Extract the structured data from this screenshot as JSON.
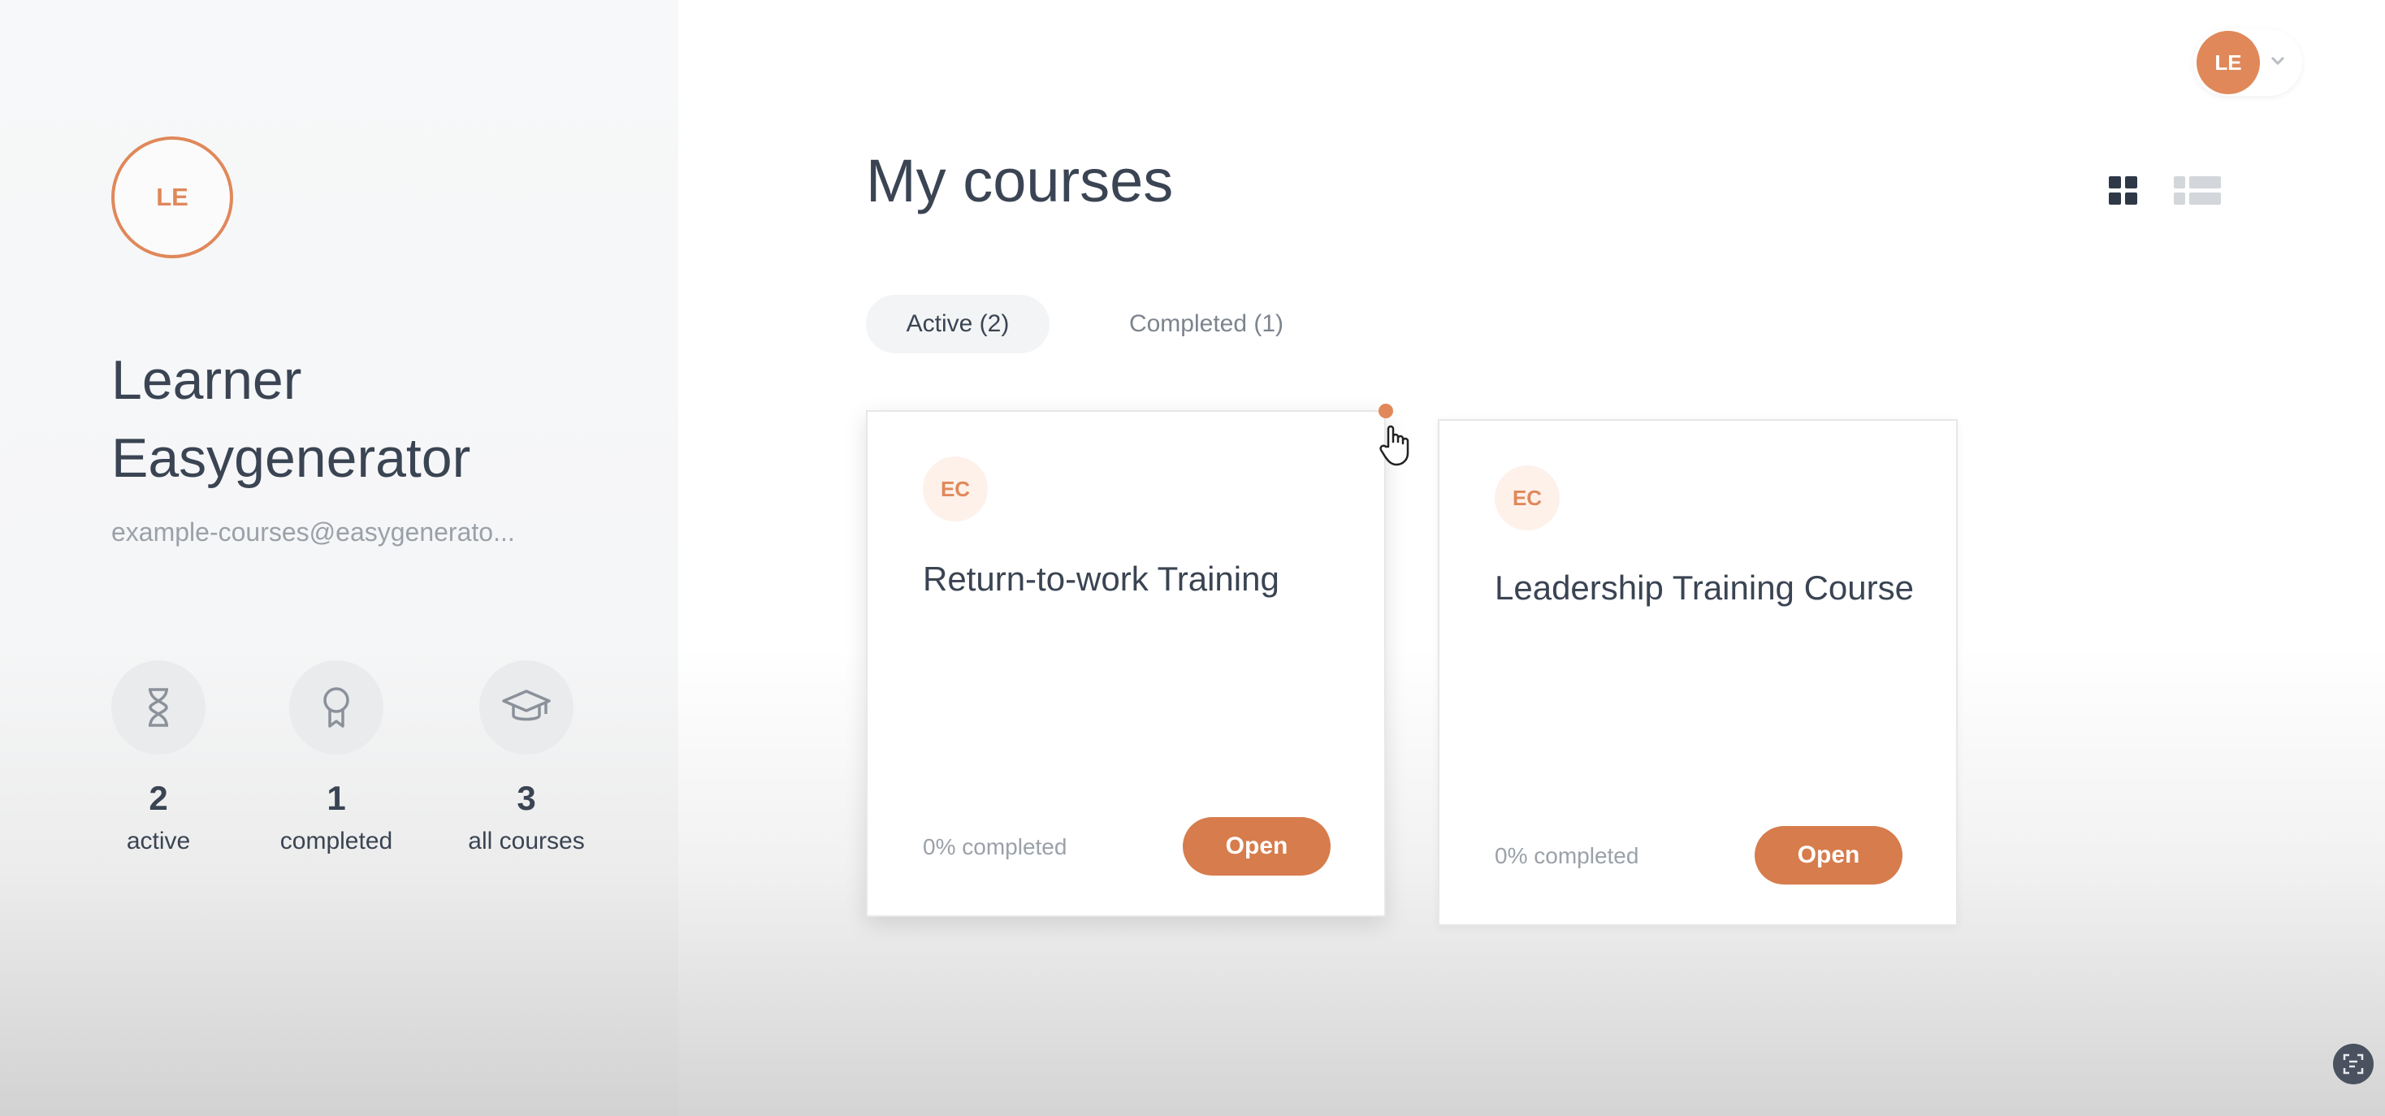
{
  "colors": {
    "accent": "#e0885a",
    "button": "#d77c4c",
    "text": "#3a4453",
    "muted": "#9ba1a9"
  },
  "profile": {
    "initials": "LE",
    "name": "Learner Easygenerator",
    "email": "example-courses@easygenerato..."
  },
  "stats": [
    {
      "icon": "hourglass-icon",
      "value": "2",
      "label": "active"
    },
    {
      "icon": "award-icon",
      "value": "1",
      "label": "completed"
    },
    {
      "icon": "graduation-cap-icon",
      "value": "3",
      "label": "all courses"
    }
  ],
  "header": {
    "user_initials": "LE",
    "menu_icon": "chevron-down-icon"
  },
  "page": {
    "title": "My courses"
  },
  "view_toggle": {
    "grid_icon": "grid-view-icon",
    "list_icon": "list-view-icon",
    "selected": "grid"
  },
  "tabs": [
    {
      "label": "Active (2)",
      "selected": true
    },
    {
      "label": "Completed (1)",
      "selected": false
    }
  ],
  "courses": [
    {
      "badge": "EC",
      "title": "Return-to-work Training",
      "progress": "0% completed",
      "button": "Open"
    },
    {
      "badge": "EC",
      "title": "Leadership Training Course",
      "progress": "0% completed",
      "button": "Open"
    }
  ]
}
